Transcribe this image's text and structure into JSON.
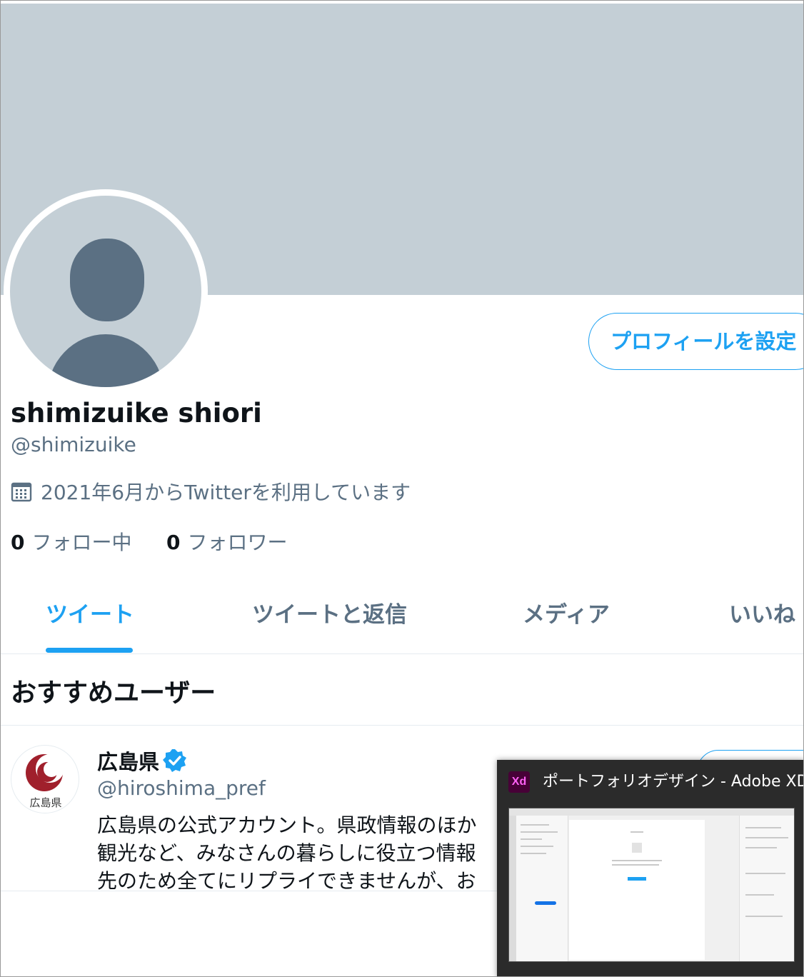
{
  "profile": {
    "display_name": "shimizuike shiori",
    "handle": "@shimizuike",
    "joined": "2021年6月からTwitterを利用しています",
    "setup_button": "プロフィールを設定",
    "following_count": "0",
    "following_label": "フォロー中",
    "followers_count": "0",
    "followers_label": "フォロワー"
  },
  "tabs": [
    {
      "label": "ツイート",
      "active": true
    },
    {
      "label": "ツイートと返信",
      "active": false
    },
    {
      "label": "メディア",
      "active": false
    },
    {
      "label": "いいね",
      "active": false
    }
  ],
  "recommended": {
    "title": "おすすめユーザー",
    "users": [
      {
        "name": "広島県",
        "handle": "@hiroshima_pref",
        "verified": true,
        "avatar_text": "広島県",
        "bio_lines": [
          "広島県の公式アカウント。県政情報のほか",
          "観光など、みなさんの暮らしに役立つ情報",
          "先のため全てにリプライできませんが、お"
        ]
      }
    ]
  },
  "taskbar_preview": {
    "app_icon": "Xd",
    "title": "ポートフォリオデザイン - Adobe XD"
  },
  "colors": {
    "accent": "#1da1f2",
    "banner": "#c4cfd6",
    "avatar_silhouette": "#5b7083",
    "secondary_text": "#5b7083",
    "hiroshima_red": "#a0202c"
  }
}
